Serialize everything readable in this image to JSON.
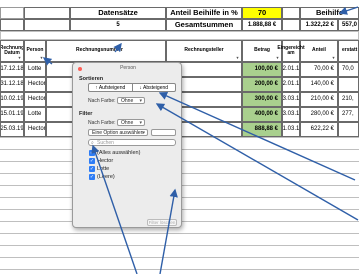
{
  "header": {
    "datensaetze_label": "Datensätze",
    "anteil_label": "Anteil Beihilfe in %",
    "anteil_value": "70",
    "beihilfe_label": "Beihilfe"
  },
  "sums": {
    "count": "5",
    "label": "Gesamtsummen",
    "betrag_sum": "1.888,88 €",
    "anteil_sum": "1.322,22 €",
    "erstattet_sum": "557,0"
  },
  "columns": {
    "rechnung_datum": "Rechnung\nDatum",
    "person": "Person",
    "rechnungsnummer": "Rechnungsnummer",
    "rechnungsteller": "Rechnungsteller",
    "betrag": "Betrag",
    "eingereicht_am": "Eingereicht\nam",
    "anteil": "Anteil",
    "erstattet": "erstatt"
  },
  "rows": [
    {
      "datum": "17.12.18",
      "person": "Lotte",
      "steller": "d",
      "betrag": "100,00 €",
      "eingereicht": "02.01.19",
      "anteil": "70,00 €",
      "erstattet": "70,0"
    },
    {
      "datum": "31.12.18",
      "person": "Hector",
      "steller": "d",
      "betrag": "200,00 €",
      "eingereicht": "02.01.19",
      "anteil": "140,00 €",
      "erstattet": ""
    },
    {
      "datum": "10.02.19",
      "person": "Hector",
      "steller": "d",
      "betrag": "300,00 €",
      "eingereicht": "03.03.19",
      "anteil": "210,00 €",
      "erstattet": "210,"
    },
    {
      "datum": "15.01.19",
      "person": "Lotte",
      "steller": "d",
      "betrag": "400,00 €",
      "eingereicht": "03.03.19",
      "anteil": "280,00 €",
      "erstattet": "277,"
    },
    {
      "datum": "25.03.19",
      "person": "Hector",
      "steller": "d",
      "betrag": "888,88 €",
      "eingereicht": "31.03.19",
      "anteil": "622,22 €",
      "erstattet": ""
    }
  ],
  "popover": {
    "title": "Person",
    "sort_label": "Sortieren",
    "sort_asc": "↑ Aufsteigend",
    "sort_desc": "↓ Absteigend",
    "by_color_label": "Nach Farbe:",
    "by_color_value": "Ohne",
    "filter_label": "Filter",
    "filter_by_color_label": "Nach Farbe:",
    "filter_by_color_value": "Ohne",
    "option_select": "Eine Option auswählen",
    "search_placeholder": "Suchen",
    "items": [
      {
        "label": "(Alles auswählen)",
        "checked": true
      },
      {
        "label": "Hector",
        "checked": true
      },
      {
        "label": "Lotte",
        "checked": true
      },
      {
        "label": "(Leere)",
        "checked": true
      }
    ],
    "clear_filter": "Filter löschen"
  },
  "colors": {
    "accent": "#2d7cf6",
    "arrow": "#2f5fa8",
    "highlight_yellow": "#ffff00",
    "betrag_green": "#a9d08e"
  }
}
